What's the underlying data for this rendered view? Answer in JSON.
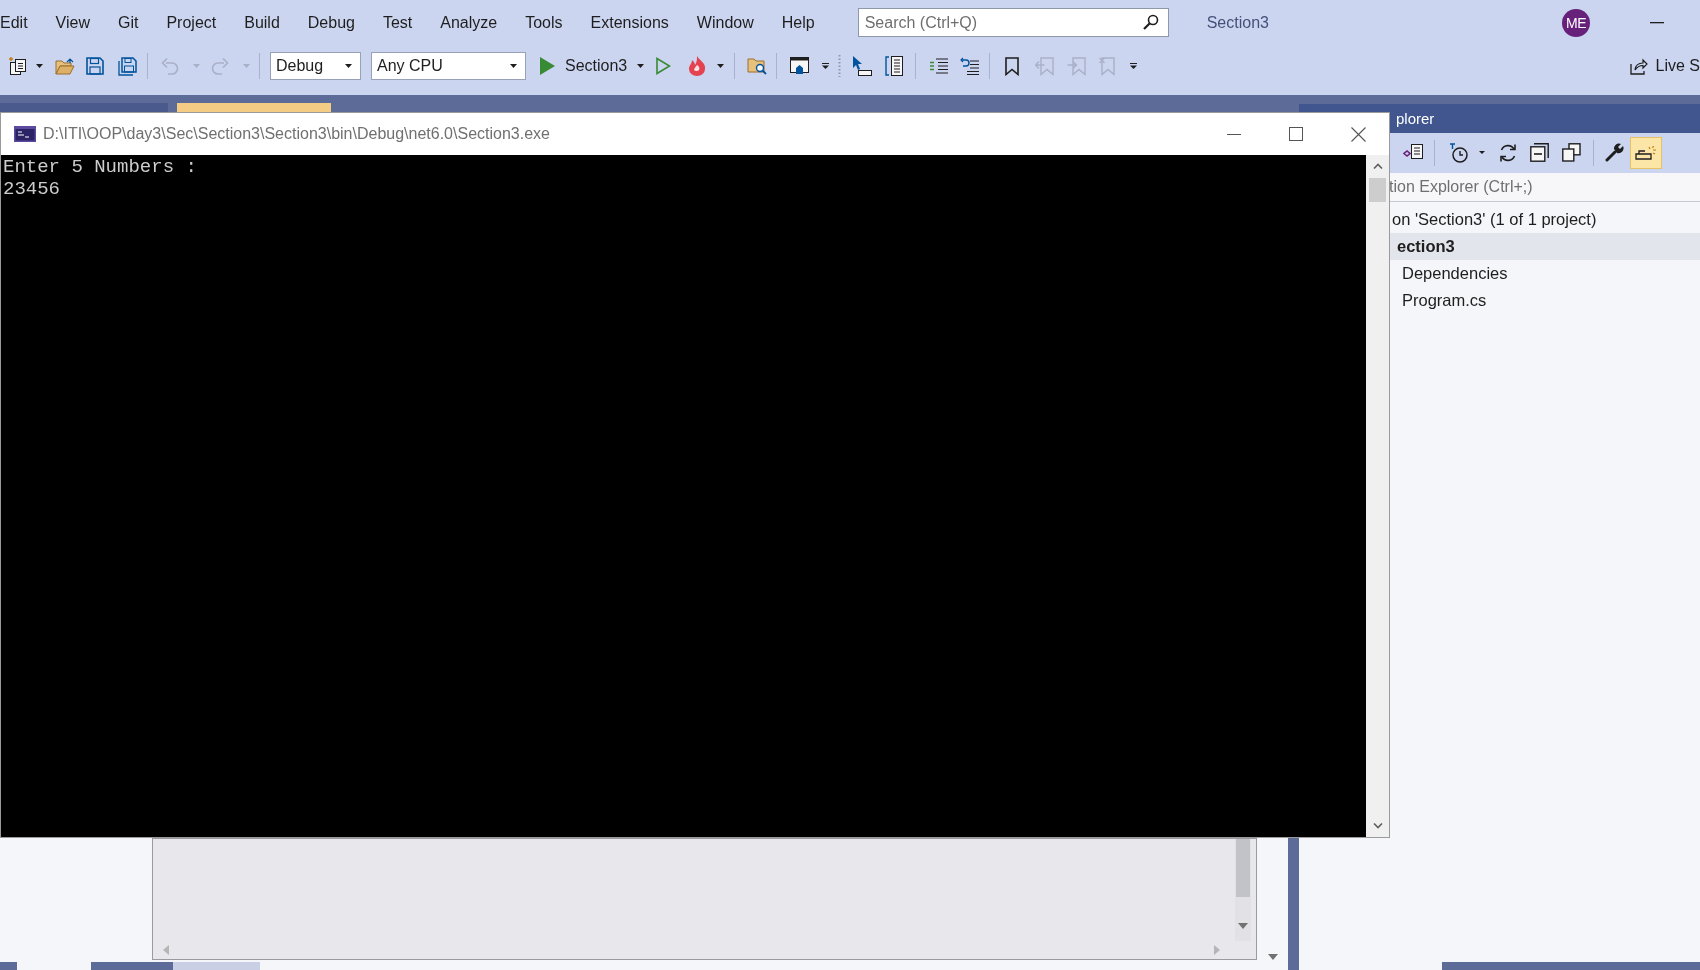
{
  "menu_bar": {
    "items": [
      "Edit",
      "View",
      "Git",
      "Project",
      "Build",
      "Debug",
      "Test",
      "Analyze",
      "Tools",
      "Extensions",
      "Window",
      "Help"
    ],
    "search": {
      "placeholder": "Search (Ctrl+Q)"
    },
    "solution_name": "Section3",
    "account_initials": "ME"
  },
  "toolbar": {
    "undo": {
      "disabled": true
    },
    "redo": {
      "disabled": true
    },
    "configuration": "Debug",
    "platform": "Any CPU",
    "start_target": "Section3",
    "bookmarks": [
      {
        "disabled": false
      },
      {
        "disabled": true
      },
      {
        "disabled": true
      },
      {
        "disabled": true
      }
    ],
    "live_share": "Live S"
  },
  "editor_tabs": [
    {
      "selected": false
    },
    {
      "selected": true
    }
  ],
  "console_window": {
    "title": "D:\\ITI\\OOP\\day3\\Sec\\Section3\\Section3\\bin\\Debug\\net6.0\\Section3.exe",
    "lines": [
      "Enter 5 Numbers :",
      "23456"
    ]
  },
  "solution_explorer": {
    "title": "plorer",
    "toolbar_toggle": {
      "on": true
    },
    "search": {
      "placeholder": "tion Explorer (Ctrl+;)"
    },
    "tree": [
      {
        "label": "on 'Section3' (1 of 1 project)",
        "startup": false,
        "selected": false,
        "children": [
          {
            "label": "ection3",
            "startup": true,
            "selected": true,
            "children": [
              {
                "label": "Dependencies",
                "startup": false,
                "selected": false
              },
              {
                "label": "Program.cs",
                "startup": false,
                "selected": false
              }
            ]
          }
        ]
      }
    ]
  }
}
